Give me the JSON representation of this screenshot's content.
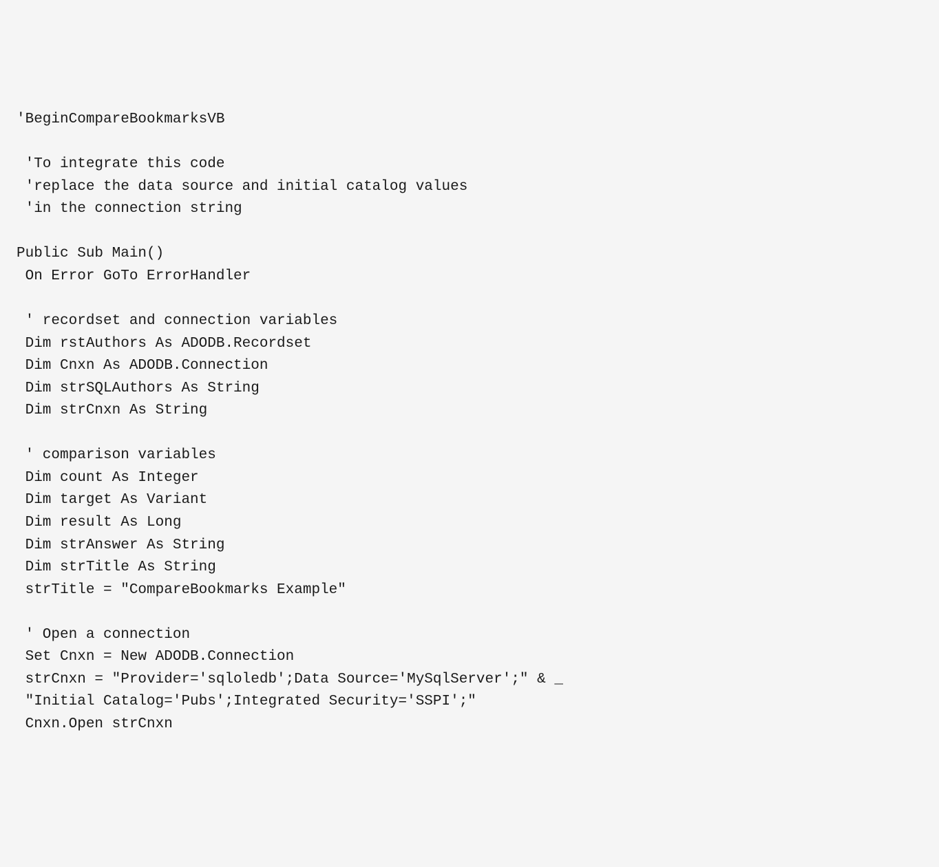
{
  "code": {
    "lines": [
      "'BeginCompareBookmarksVB",
      "",
      " 'To integrate this code",
      " 'replace the data source and initial catalog values",
      " 'in the connection string",
      "",
      "Public Sub Main()",
      " On Error GoTo ErrorHandler",
      "",
      " ' recordset and connection variables",
      " Dim rstAuthors As ADODB.Recordset",
      " Dim Cnxn As ADODB.Connection",
      " Dim strSQLAuthors As String",
      " Dim strCnxn As String",
      "",
      " ' comparison variables",
      " Dim count As Integer",
      " Dim target As Variant",
      " Dim result As Long",
      " Dim strAnswer As String",
      " Dim strTitle As String",
      " strTitle = \"CompareBookmarks Example\"",
      "",
      " ' Open a connection",
      " Set Cnxn = New ADODB.Connection",
      " strCnxn = \"Provider='sqloledb';Data Source='MySqlServer';\" & _",
      " \"Initial Catalog='Pubs';Integrated Security='SSPI';\"",
      " Cnxn.Open strCnxn"
    ]
  }
}
